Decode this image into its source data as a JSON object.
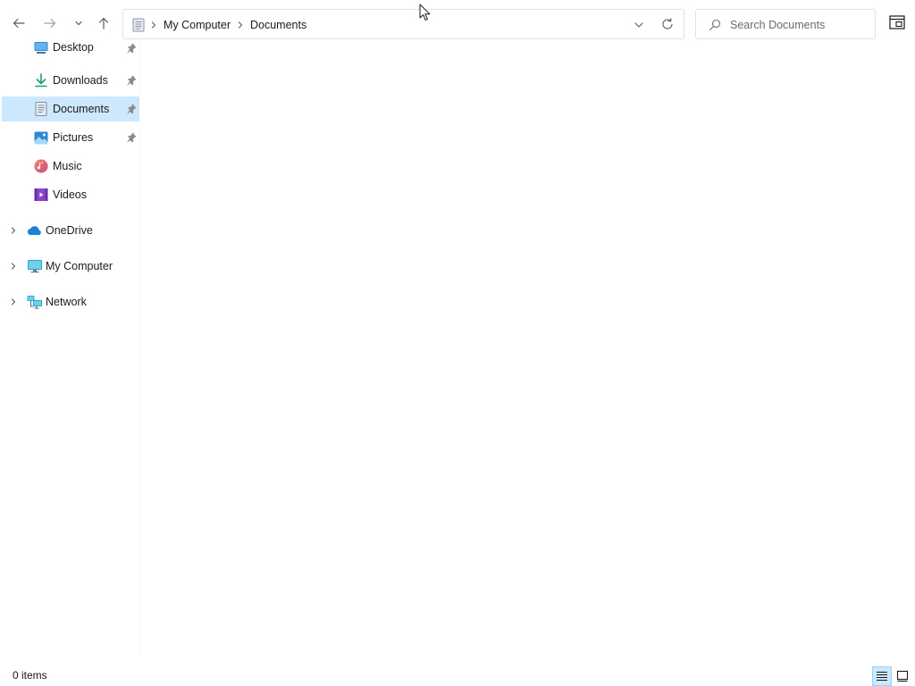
{
  "toolbar": {
    "back_icon": "arrow-left-icon",
    "forward_icon": "arrow-right-icon",
    "recent_icon": "chevron-down-icon",
    "up_icon": "arrow-up-icon"
  },
  "address_bar": {
    "location_icon": "documents-icon",
    "breadcrumbs": [
      "My Computer",
      "Documents"
    ],
    "dropdown_icon": "chevron-down-icon",
    "refresh_icon": "refresh-icon"
  },
  "search": {
    "placeholder": "Search Documents",
    "value": "",
    "icon": "search-icon"
  },
  "sidebar": {
    "quick_access": [
      {
        "label": "Desktop",
        "icon": "desktop-icon",
        "pinned": true,
        "selected": false
      },
      {
        "label": "Downloads",
        "icon": "download-icon",
        "pinned": true,
        "selected": false
      },
      {
        "label": "Documents",
        "icon": "documents-icon",
        "pinned": true,
        "selected": true
      },
      {
        "label": "Pictures",
        "icon": "pictures-icon",
        "pinned": true,
        "selected": false
      },
      {
        "label": "Music",
        "icon": "music-icon",
        "pinned": false,
        "selected": false
      },
      {
        "label": "Videos",
        "icon": "videos-icon",
        "pinned": false,
        "selected": false
      }
    ],
    "tree": [
      {
        "label": "OneDrive",
        "icon": "cloud-icon"
      },
      {
        "label": "My Computer",
        "icon": "computer-icon"
      },
      {
        "label": "Network",
        "icon": "network-icon"
      }
    ]
  },
  "status_bar": {
    "item_count": "0 items",
    "active_view": "details"
  },
  "colors": {
    "selection": "#cce8ff",
    "selection_border": "#99d1ff",
    "border": "#e1e1e1",
    "text": "#1a1a1a",
    "muted_text": "#6b6b6b"
  }
}
